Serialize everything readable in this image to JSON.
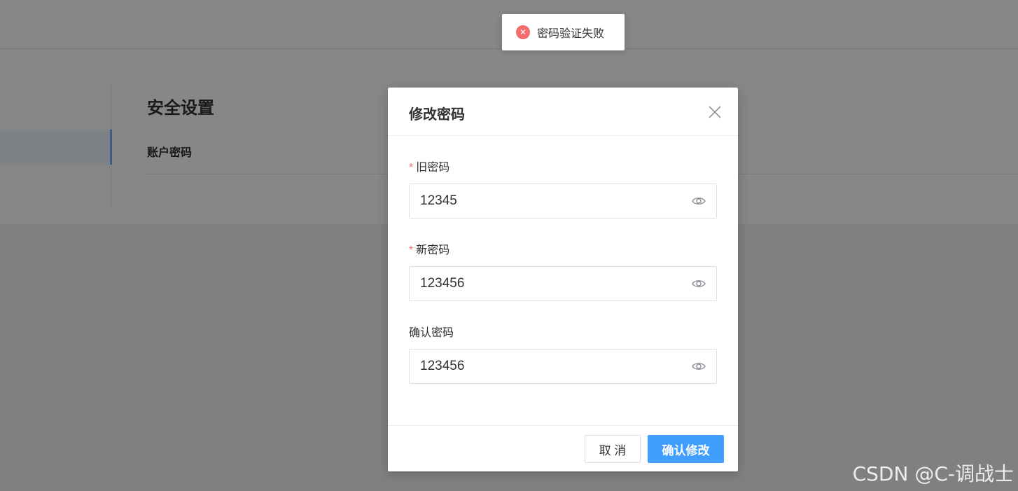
{
  "background": {
    "page_title": "安全设置",
    "section_label": "账户密码"
  },
  "toast": {
    "type": "error",
    "icon": "close-circle-icon",
    "icon_glyph": "✕",
    "message": "密码验证失败",
    "color": "#f56c6c"
  },
  "dialog": {
    "title": "修改密码",
    "close_icon": "close-icon",
    "fields": [
      {
        "label": "旧密码",
        "required": "*",
        "value": "12345",
        "icon": "eye-icon"
      },
      {
        "label": "新密码",
        "required": "*",
        "value": "123456",
        "icon": "eye-icon"
      },
      {
        "label": "确认密码",
        "required": "",
        "value": "123456",
        "icon": "eye-icon"
      }
    ],
    "cancel_label": "取 消",
    "confirm_label": "确认修改"
  },
  "colors": {
    "primary": "#409eff",
    "danger": "#f56c6c"
  },
  "watermark": "CSDN @C-调战士"
}
